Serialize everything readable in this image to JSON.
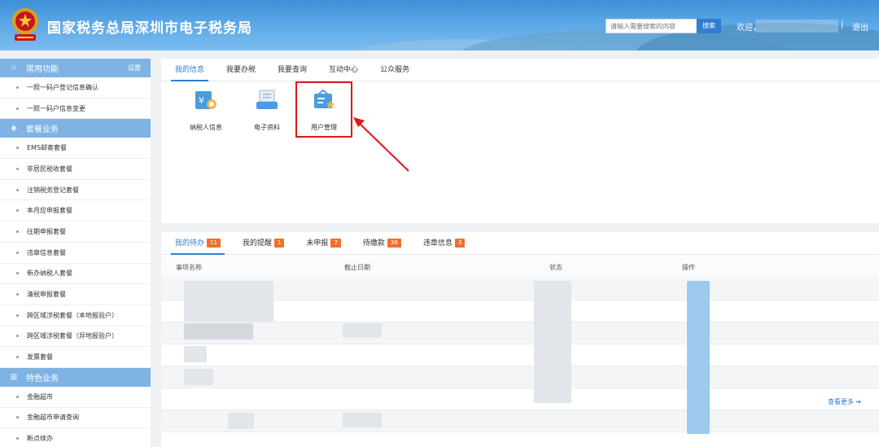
{
  "header": {
    "site_title": "国家税务总局深圳市电子税务局",
    "search_placeholder": "请输入需要搜索的内容",
    "search_button": "搜索",
    "welcome": "欢迎，",
    "separator": "|",
    "logout": "退出"
  },
  "sidebar": {
    "groups": [
      {
        "title": "常用功能",
        "icon": "star-icon",
        "setting": "设置",
        "items": [
          "一照一码户登记信息确认",
          "一照一码户信息变更"
        ]
      },
      {
        "title": "套餐业务",
        "icon": "layers-icon",
        "items": [
          "EMS邮寄套餐",
          "非居民税收套餐",
          "注销税务登记套餐",
          "本月应申报套餐",
          "往期申报套餐",
          "违章信息套餐",
          "新办纳税人套餐",
          "清税申报套餐",
          "跨区域涉税套餐（本地报验户）",
          "跨区域涉税套餐（异地报验户）",
          "发票套餐"
        ]
      },
      {
        "title": "特色业务",
        "icon": "grid-icon",
        "items": [
          "金融超市",
          "金融超市申请查询",
          "断点续办"
        ]
      }
    ]
  },
  "top_panel": {
    "tabs": [
      "我的信息",
      "我要办税",
      "我要查询",
      "互动中心",
      "公众服务"
    ],
    "active_tab": 0,
    "tiles": [
      {
        "label": "纳税人信息",
        "icon": "taxpayer-info-icon"
      },
      {
        "label": "电子资料",
        "icon": "electronic-docs-icon"
      },
      {
        "label": "用户管理",
        "icon": "user-management-icon"
      }
    ],
    "highlight_color": "#e0161b"
  },
  "bottom_panel": {
    "tabs": [
      {
        "label": "我的待办",
        "badge": "11"
      },
      {
        "label": "我的提醒",
        "badge": "1"
      },
      {
        "label": "未申报",
        "badge": "7"
      },
      {
        "label": "待缴款",
        "badge": "36"
      },
      {
        "label": "违章信息",
        "badge": "3"
      }
    ],
    "active_tab": 0,
    "columns": [
      "事项名称",
      "截止日期",
      "状态",
      "操作"
    ],
    "more_link": "查看更多"
  },
  "colors": {
    "accent": "#2e7fd0",
    "badge": "#f0702b",
    "sidebar_group": "#7fb3e4"
  }
}
